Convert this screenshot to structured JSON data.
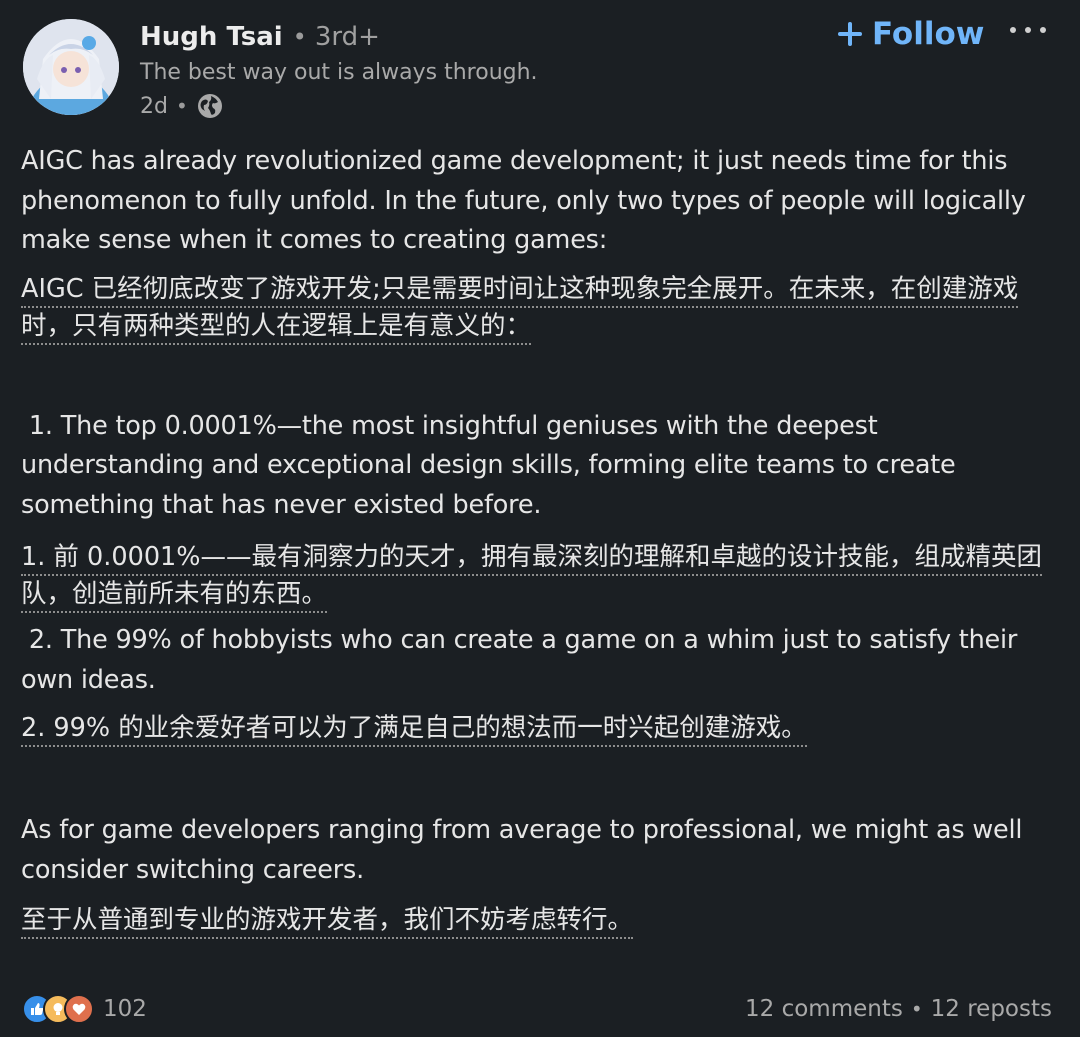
{
  "author": {
    "name": "Hugh Tsai",
    "degree": "3rd+",
    "headline": "The best way out is always through.",
    "time_ago": "2d",
    "separator": "•"
  },
  "actions": {
    "follow_label": "Follow"
  },
  "post": {
    "p1_en": "AIGC has already revolutionized game development; it just needs time for this phenomenon to fully unfold. In the future, only two types of people will logically make sense when it comes to creating games:",
    "p1_zh": "AIGC 已经彻底改变了游戏开发;只是需要时间让这种现象完全展开。在未来，在创建游戏时，只有两种类型的人在逻辑上是有意义的：",
    "item1_en": " 1. The top 0.0001%—the most insightful geniuses with the deepest understanding and exceptional design skills, forming elite teams to create something that has never existed before.",
    "item1_zh": "1. 前 0.0001%——最有洞察力的天才，拥有最深刻的理解和卓越的设计技能，组成精英团队，创造前所未有的东西。",
    "item2_en": " 2. The 99% of hobbyists who can create a game on a whim just to satisfy their own ideas.",
    "item2_zh": "2. 99% 的业余爱好者可以为了满足自己的想法而一时兴起创建游戏。",
    "p3_en": "As for game developers ranging from average to professional, we might as well consider switching careers.",
    "p3_zh": "至于从普通到专业的游戏开发者，我们不妨考虑转行。"
  },
  "social": {
    "reaction_icons": [
      "like-icon",
      "insightful-icon",
      "love-icon"
    ],
    "reaction_count": "102",
    "comments": "12 comments",
    "reposts": "12 reposts"
  },
  "colors": {
    "background": "#1b1f23",
    "accent": "#70b5f9",
    "text": "#e6e6e6",
    "muted": "#a9a9a9"
  }
}
